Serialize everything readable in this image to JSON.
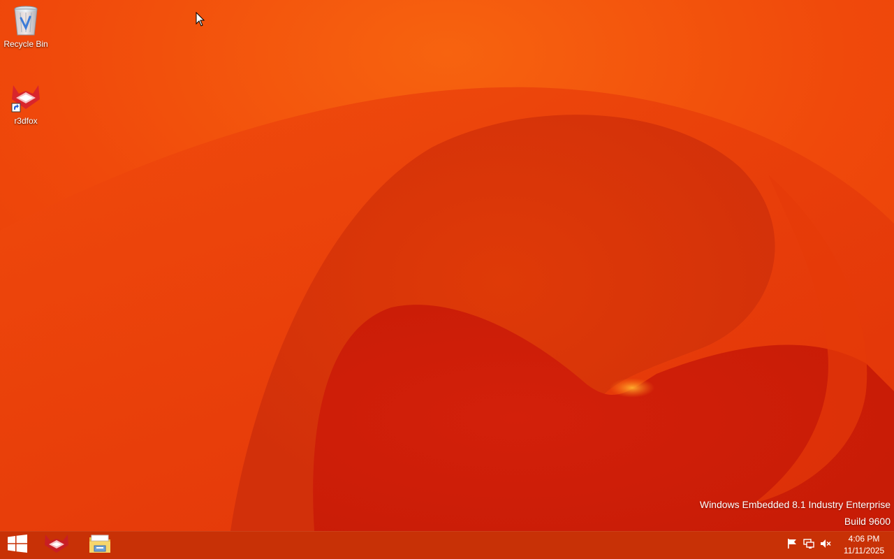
{
  "desktop": {
    "icons": [
      {
        "label": "Recycle Bin",
        "icon": "recycle-bin-icon"
      },
      {
        "label": "r3dfox",
        "icon": "r3dfox-icon",
        "shortcut": true
      }
    ]
  },
  "watermark": {
    "line1": "Windows Embedded 8.1 Industry Enterprise",
    "line2": "Build 9600"
  },
  "taskbar": {
    "start_icon": "windows-logo-icon",
    "pinned": [
      {
        "icon": "r3dfox-icon"
      },
      {
        "icon": "file-explorer-icon"
      }
    ],
    "tray": [
      {
        "icon": "action-center-flag-icon"
      },
      {
        "icon": "network-icon"
      },
      {
        "icon": "volume-muted-icon"
      }
    ],
    "clock": {
      "time": "4:06 PM",
      "date": "11/11/2025"
    }
  },
  "colors": {
    "wallpaper_base": "#f04a0c",
    "wallpaper_deep": "#d61c04",
    "taskbar": "#c2290a",
    "text": "#ffffff"
  }
}
